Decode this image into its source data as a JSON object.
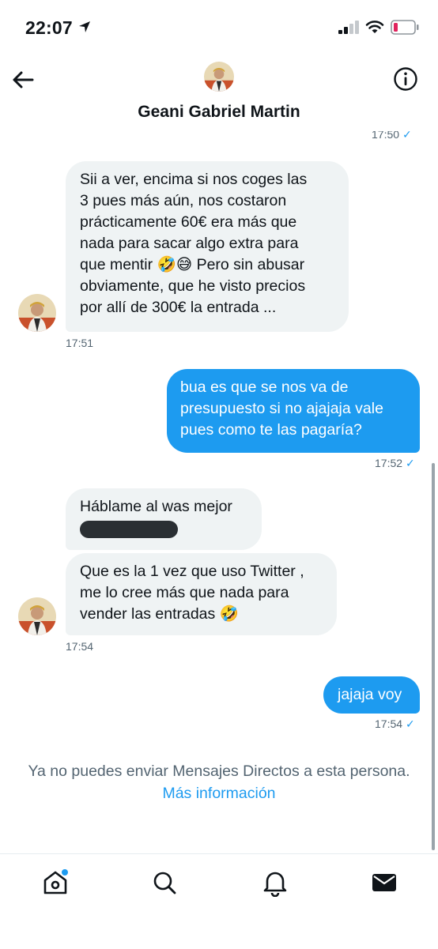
{
  "status": {
    "time": "22:07"
  },
  "header": {
    "name": "Geani Gabriel Martin"
  },
  "messages": {
    "prev_time": "17:50",
    "m1": {
      "lines": [
        "Sii a ver, encima si nos coges las",
        "3 pues más aún, nos costaron",
        "prácticamente 60€ era más que",
        "nada para sacar algo extra para",
        "que mentir 🤣😅 Pero sin abusar",
        "obviamente, que he visto precios",
        "por allí de 300€ la entrada ..."
      ],
      "time": "17:51"
    },
    "m2": {
      "lines": [
        "bua es que se nos va de",
        "presupuesto si no ajajaja vale",
        "pues como te las pagaría?"
      ],
      "time": "17:52"
    },
    "m3": {
      "lines": [
        "Háblame al was mejor"
      ]
    },
    "m4": {
      "lines": [
        "Que es la 1 vez que uso Twitter ,",
        "me lo cree más que nada para",
        "vender las entradas 🤣"
      ],
      "time": "17:54"
    },
    "m5": {
      "lines": [
        "jajaja voy"
      ],
      "time": "17:54"
    },
    "check": "✓"
  },
  "notice": {
    "text": "Ya no puedes enviar Mensajes Directos a esta persona.",
    "link": "Más información"
  },
  "icons": {
    "accent": "#1d9bf0"
  }
}
